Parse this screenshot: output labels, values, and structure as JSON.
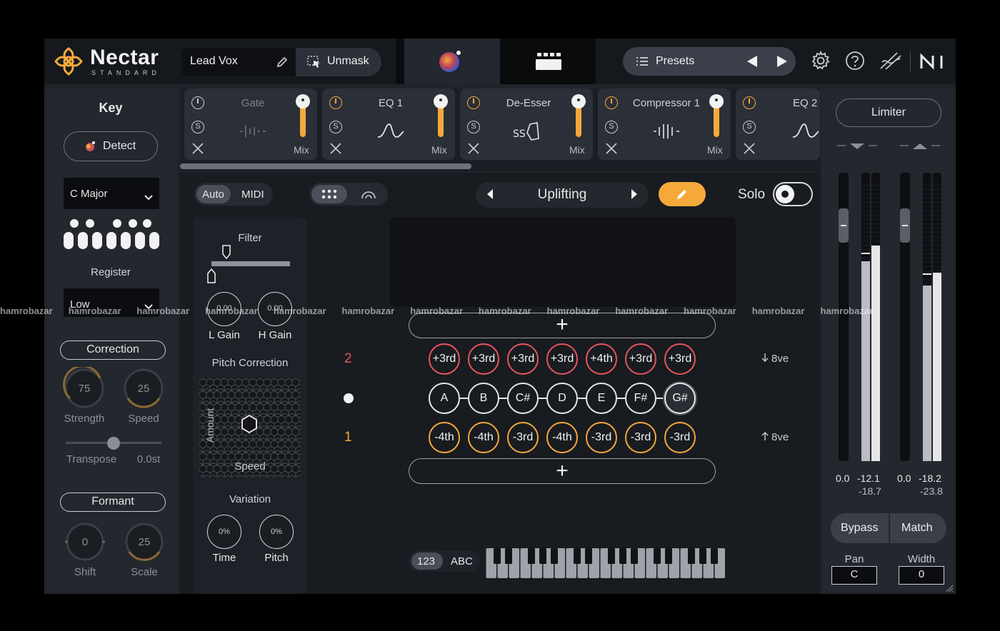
{
  "app": {
    "logo_name": "Nectar",
    "logo_edition": "STANDARD",
    "preset_name": "Lead Vox",
    "unmask_label": "Unmask",
    "presets_label": "Presets"
  },
  "colors": {
    "accent": "#f4a93a",
    "red": "#e8545d",
    "panel": "#23272e"
  },
  "key_panel": {
    "title": "Key",
    "detect_label": "Detect",
    "key_value": "C Major",
    "register_label": "Register",
    "register_value": "Low",
    "correction_label": "Correction",
    "strength_value": "75",
    "strength_label": "Strength",
    "speed_value": "25",
    "speed_label": "Speed",
    "transpose_label": "Transpose",
    "transpose_value": "0.0st",
    "formant_label": "Formant",
    "shift_value": "0",
    "shift_label": "Shift",
    "scale_value": "25",
    "scale_label": "Scale"
  },
  "modules": [
    {
      "name": "Gate",
      "mix_label": "Mix",
      "active": false
    },
    {
      "name": "EQ 1",
      "mix_label": "Mix",
      "active": true
    },
    {
      "name": "De-Esser",
      "mix_label": "Mix",
      "active": true
    },
    {
      "name": "Compressor 1",
      "mix_label": "Mix",
      "active": true
    },
    {
      "name": "EQ 2",
      "active": true
    }
  ],
  "harmony": {
    "mode_auto": "Auto",
    "mode_midi": "MIDI",
    "style_name": "Uplifting",
    "solo_label": "Solo",
    "filter_label": "Filter",
    "l_gain_value": "0.00",
    "l_gain_label": "L Gain",
    "h_gain_value": "0.00",
    "h_gain_label": "H Gain",
    "pitch_correction_label": "Pitch Correction",
    "amount_label": "Amount",
    "speed_axis_label": "Speed",
    "variation_label": "Variation",
    "time_value": "0%",
    "time_label": "Time",
    "pitch_value": "0%",
    "pitch_label": "Pitch",
    "add_symbol": "+",
    "row_upper_num": "2",
    "row_lower_num": "1",
    "upper_notes": [
      "+3rd",
      "+3rd",
      "+3rd",
      "+3rd",
      "+4th",
      "+3rd",
      "+3rd"
    ],
    "scale_notes": [
      "A",
      "B",
      "C#",
      "D",
      "E",
      "F#",
      "G#"
    ],
    "lower_notes": [
      "-4th",
      "-4th",
      "-3rd",
      "-4th",
      "-3rd",
      "-3rd",
      "-3rd"
    ],
    "octave_down": "8ve",
    "octave_up": "8ve",
    "label_numbers": "123",
    "label_letters": "ABC"
  },
  "limiter": {
    "title": "Limiter",
    "left_in_peak": "0.0",
    "left_out_peak": "-12.1",
    "left_out_rms": "-18.7",
    "right_in_peak": "0.0",
    "right_out_peak": "-18.2",
    "right_out_rms": "-23.8",
    "bypass_label": "Bypass",
    "match_label": "Match",
    "pan_label": "Pan",
    "pan_value": "C",
    "width_label": "Width",
    "width_value": "0"
  },
  "watermark": {
    "text": "hamrobazar"
  }
}
